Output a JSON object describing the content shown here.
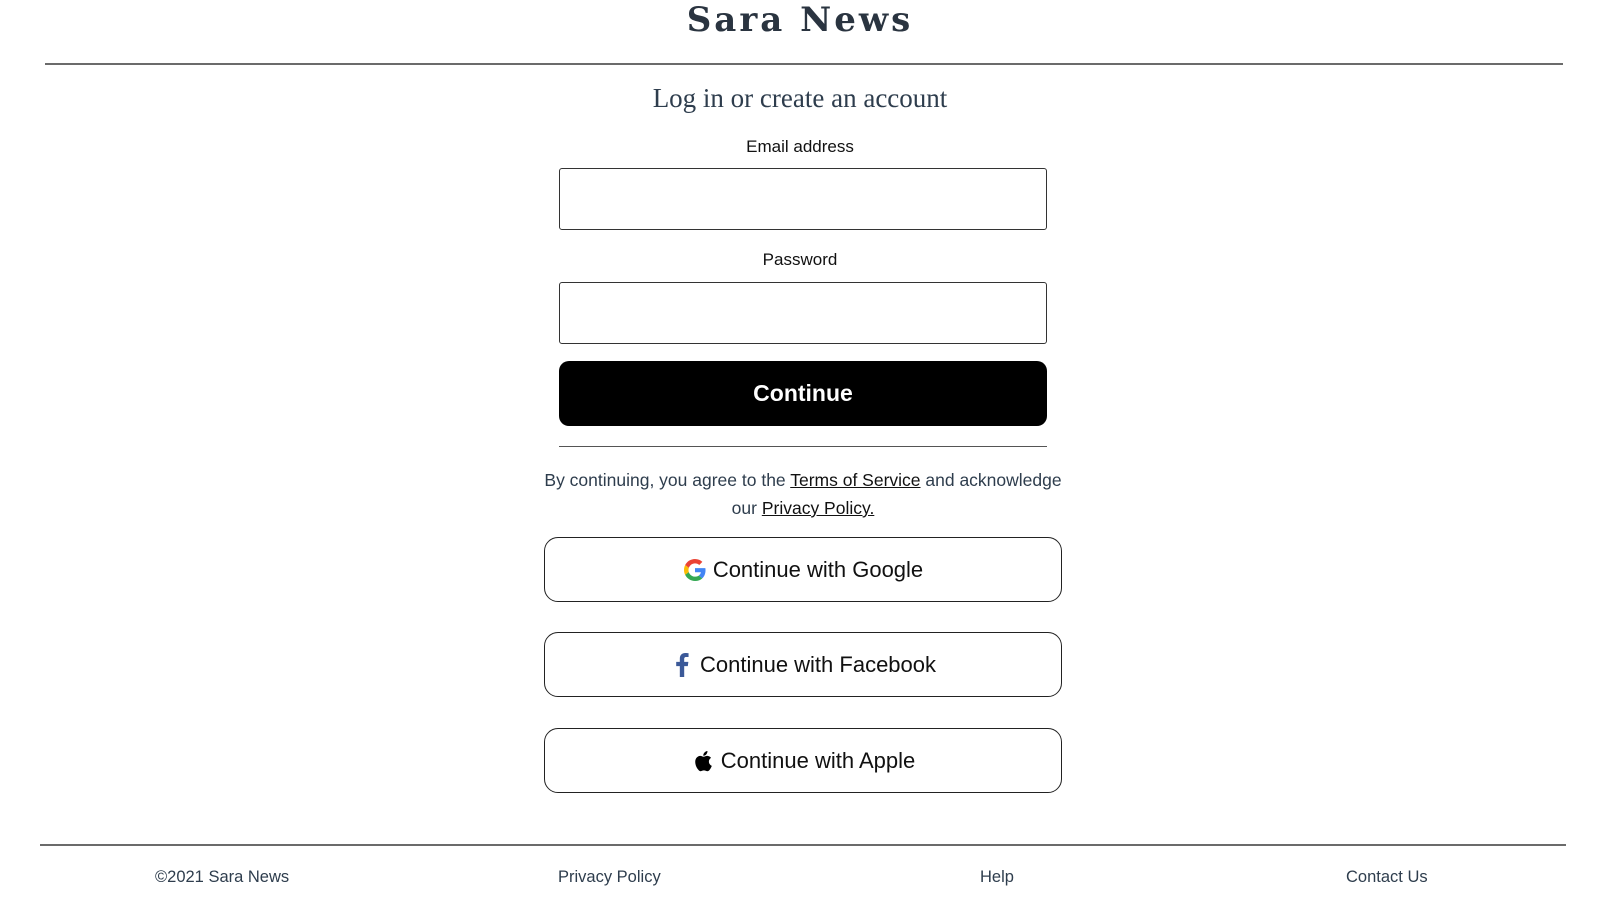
{
  "header": {
    "brand": "Sara News"
  },
  "form": {
    "title": "Log in or create an account",
    "email_label": "Email address",
    "email_value": "",
    "password_label": "Password",
    "password_value": "",
    "continue_label": "Continue"
  },
  "legal": {
    "prefix": "By continuing, you agree to the ",
    "terms_link": "Terms of Service",
    "middle": " and acknowledge our ",
    "privacy_link": "Privacy Policy."
  },
  "social": {
    "google_label": "Continue with Google",
    "facebook_label": "Continue with Facebook",
    "apple_label": "Continue with Apple"
  },
  "footer": {
    "copyright": "©2021 Sara News",
    "privacy": "Privacy Policy",
    "help": "Help",
    "contact": "Contact Us"
  },
  "colors": {
    "brand_text": "#2a3440",
    "primary_button": "#000000",
    "facebook_blue": "#3b5998",
    "google_blue": "#4285F4",
    "google_red": "#EA4335",
    "google_yellow": "#FBBC05",
    "google_green": "#34A853"
  },
  "icons": {
    "google": "google-g-icon",
    "facebook": "facebook-f-icon",
    "apple": "apple-icon"
  }
}
